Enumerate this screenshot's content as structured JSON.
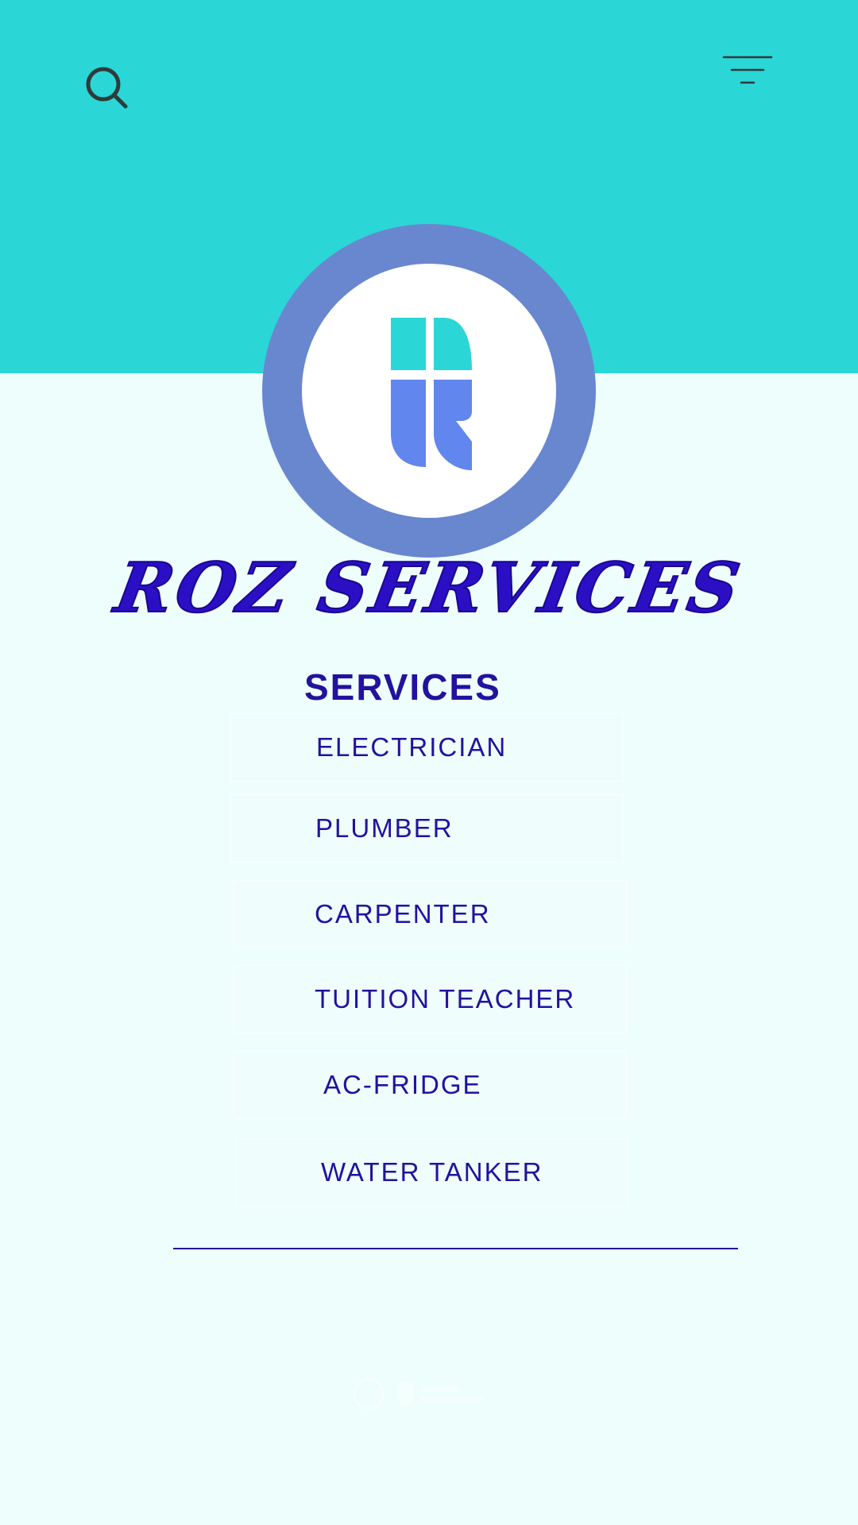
{
  "colors": {
    "header_background": "#2bd6d6",
    "page_background": "#eefefd",
    "logo_ring": "#6987cf",
    "logo_top": "#2bd6d6",
    "logo_bottom": "#6186ed",
    "text_primary": "#22129e",
    "icon_color": "#2f3a3a"
  },
  "header": {
    "search_icon": "search-icon",
    "menu_icon": "filter-menu-icon"
  },
  "logo": {
    "icon": "r-letter-logo"
  },
  "brand": {
    "title": "ROZ SERVICES"
  },
  "services": {
    "heading": "SERVICES",
    "items": [
      {
        "label": "ELECTRICIAN"
      },
      {
        "label": "PLUMBER"
      },
      {
        "label": "CARPENTER"
      },
      {
        "label": "TUITION TEACHER"
      },
      {
        "label": "AC-FRIDGE"
      },
      {
        "label": "WATER TANKER"
      }
    ]
  }
}
